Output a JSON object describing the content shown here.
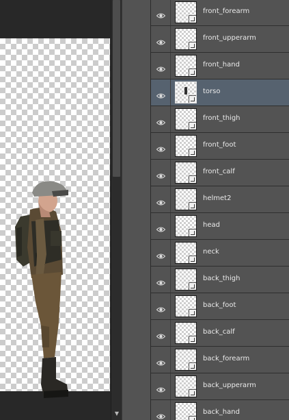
{
  "colors": {
    "panel_bg": "#535353",
    "selected_row": "#56626f",
    "canvas_bg": "#282828",
    "text": "#eaeaea"
  },
  "layers": [
    {
      "name": "front_forearm",
      "visible": true,
      "selected": false,
      "icon": "eye-icon"
    },
    {
      "name": "front_upperarm",
      "visible": true,
      "selected": false,
      "icon": "eye-icon"
    },
    {
      "name": "front_hand",
      "visible": true,
      "selected": false,
      "icon": "eye-icon"
    },
    {
      "name": "torso",
      "visible": true,
      "selected": true,
      "icon": "eye-icon"
    },
    {
      "name": "front_thigh",
      "visible": true,
      "selected": false,
      "icon": "eye-icon"
    },
    {
      "name": "front_foot",
      "visible": true,
      "selected": false,
      "icon": "eye-icon"
    },
    {
      "name": "front_calf",
      "visible": true,
      "selected": false,
      "icon": "eye-icon"
    },
    {
      "name": "helmet2",
      "visible": true,
      "selected": false,
      "icon": "eye-icon"
    },
    {
      "name": "head",
      "visible": true,
      "selected": false,
      "icon": "eye-icon"
    },
    {
      "name": "neck",
      "visible": true,
      "selected": false,
      "icon": "eye-icon"
    },
    {
      "name": "back_thigh",
      "visible": true,
      "selected": false,
      "icon": "eye-icon"
    },
    {
      "name": "back_foot",
      "visible": true,
      "selected": false,
      "icon": "eye-icon"
    },
    {
      "name": "back_calf",
      "visible": true,
      "selected": false,
      "icon": "eye-icon"
    },
    {
      "name": "back_forearm",
      "visible": true,
      "selected": false,
      "icon": "eye-icon"
    },
    {
      "name": "back_upperarm",
      "visible": true,
      "selected": false,
      "icon": "eye-icon"
    },
    {
      "name": "back_hand",
      "visible": true,
      "selected": false,
      "icon": "eye-icon"
    }
  ]
}
